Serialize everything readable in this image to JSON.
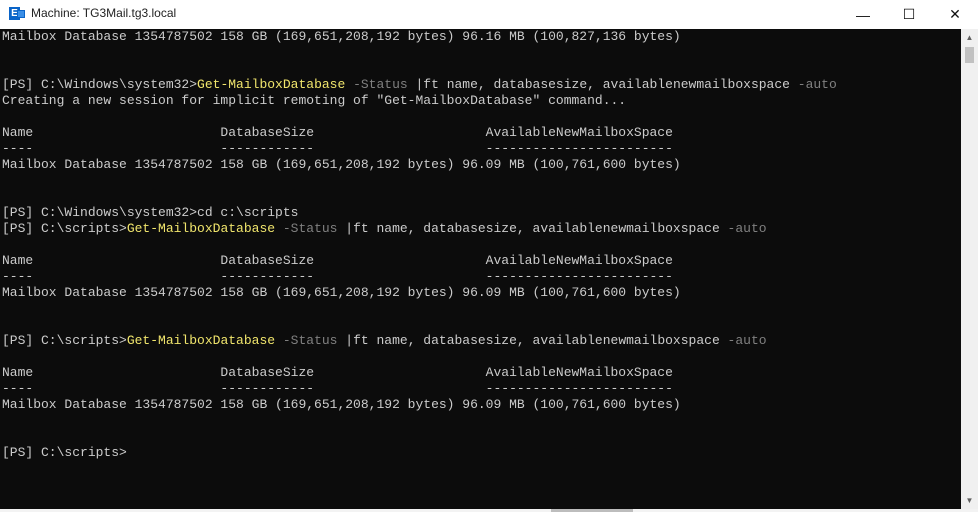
{
  "window": {
    "title": "Machine: TG3Mail.tg3.local",
    "app_icon": "exchange-management-shell-icon",
    "controls": {
      "minimize": "—",
      "maximize": "☐",
      "close": "✕"
    }
  },
  "terminal": {
    "background": "#0c0c0c",
    "text_color": "#cccccc",
    "command_color": "#f0e56c",
    "parameter_color": "#808080",
    "lines": [
      {
        "t": "Mailbox Database 1354787502 158 GB (169,651,208,192 bytes) 96.16 MB (100,827,136 bytes)"
      },
      {
        "t": ""
      },
      {
        "t": ""
      },
      {
        "prompt": "[PS] C:\\Windows\\system32>",
        "cmd": "Get-MailboxDatabase",
        "param": " -Status ",
        "rest": "|ft name, databasesize, availablenewmailboxspace ",
        "param2": "-auto"
      },
      {
        "t": "Creating a new session for implicit remoting of \"Get-MailboxDatabase\" command..."
      },
      {
        "t": ""
      },
      {
        "t": "Name                        DatabaseSize                      AvailableNewMailboxSpace"
      },
      {
        "t": "----                        ------------                      ------------------------"
      },
      {
        "t": "Mailbox Database 1354787502 158 GB (169,651,208,192 bytes) 96.09 MB (100,761,600 bytes)"
      },
      {
        "t": ""
      },
      {
        "t": ""
      },
      {
        "t": "[PS] C:\\Windows\\system32>cd c:\\scripts"
      },
      {
        "prompt": "[PS] C:\\scripts>",
        "cmd": "Get-MailboxDatabase",
        "param": " -Status ",
        "rest": "|ft name, databasesize, availablenewmailboxspace ",
        "param2": "-auto"
      },
      {
        "t": ""
      },
      {
        "t": "Name                        DatabaseSize                      AvailableNewMailboxSpace"
      },
      {
        "t": "----                        ------------                      ------------------------"
      },
      {
        "t": "Mailbox Database 1354787502 158 GB (169,651,208,192 bytes) 96.09 MB (100,761,600 bytes)"
      },
      {
        "t": ""
      },
      {
        "t": ""
      },
      {
        "prompt": "[PS] C:\\scripts>",
        "cmd": "Get-MailboxDatabase",
        "param": " -Status ",
        "rest": "|ft name, databasesize, availablenewmailboxspace ",
        "param2": "-auto"
      },
      {
        "t": ""
      },
      {
        "t": "Name                        DatabaseSize                      AvailableNewMailboxSpace"
      },
      {
        "t": "----                        ------------                      ------------------------"
      },
      {
        "t": "Mailbox Database 1354787502 158 GB (169,651,208,192 bytes) 96.09 MB (100,761,600 bytes)"
      },
      {
        "t": ""
      },
      {
        "t": ""
      },
      {
        "t": "[PS] C:\\scripts>"
      }
    ]
  },
  "scrollbar": {
    "up_arrow": "▲",
    "down_arrow": "▼"
  }
}
